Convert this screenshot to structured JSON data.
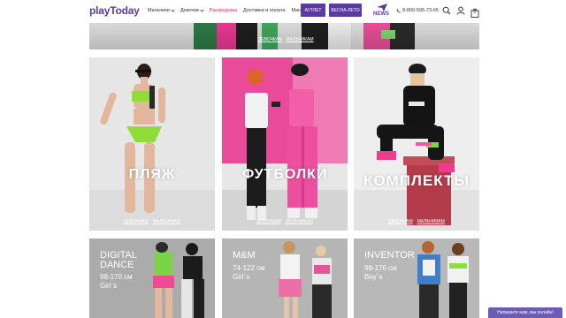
{
  "header": {
    "logo": "playToday",
    "nav": [
      {
        "label": "Мальчики",
        "has_dropdown": true
      },
      {
        "label": "Девочки",
        "has_dropdown": true
      },
      {
        "label": "Распродажа",
        "has_dropdown": false
      },
      {
        "label": "Доставка и оплата",
        "has_dropdown": false
      },
      {
        "label": "Магазины",
        "has_dropdown": false
      }
    ],
    "outlet_button": "АУТЛЕТ",
    "spring_button": "ВЕСНА-ЛЕТО",
    "news_label": "NEWS",
    "phone": "8-800-505-73-65",
    "cart_count": "0",
    "brand_color": "#5b3aa3",
    "sale_color": "#e2306c"
  },
  "banner": {
    "links": [
      "ДЕВОЧКАМ",
      "МАЛЬЧИКАМ"
    ]
  },
  "categories": [
    {
      "title": "ПЛЯЖ",
      "links": [
        "ДЕВОЧКАМ",
        "МАЛЬЧИКАМ"
      ]
    },
    {
      "title": "ФУТБОЛКИ",
      "links": [
        "ДЕВОЧКАМ",
        "МАЛЬЧИКАМ"
      ]
    },
    {
      "title": "КОМПЛЕКТЫ",
      "links": [
        "ДЕВОЧКАМ",
        "МАЛЬЧИКАМ"
      ]
    }
  ],
  "collections": [
    {
      "line1": "DIGITAL",
      "line2": "DANCE",
      "size": "98-170 см",
      "gender": "Girl`s"
    },
    {
      "line1": "M&M",
      "line2": "",
      "size": "74-122 см",
      "gender": "Girl`s"
    },
    {
      "line1": "INVENTOR",
      "line2": "",
      "size": "98-176 см",
      "gender": "Boy`s"
    }
  ],
  "chat_label": "Напишите нам, мы онлайн!"
}
